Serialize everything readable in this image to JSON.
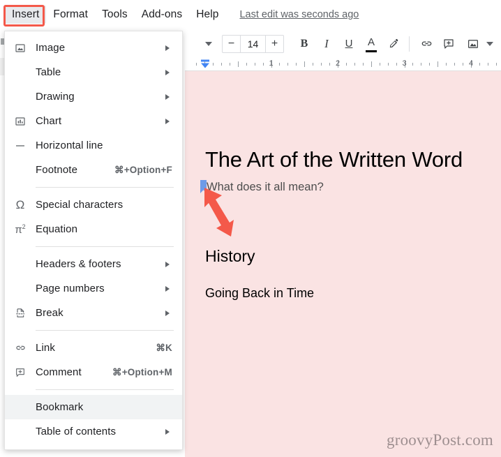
{
  "menubar": {
    "items": [
      {
        "label": "Insert",
        "active": true
      },
      {
        "label": "Format",
        "active": false
      },
      {
        "label": "Tools",
        "active": false
      },
      {
        "label": "Add-ons",
        "active": false
      },
      {
        "label": "Help",
        "active": false
      }
    ],
    "last_edit": "Last edit was seconds ago"
  },
  "toolbar": {
    "font_dropdown_icon": "caret-down-icon",
    "decrease_font_label": "−",
    "font_size_value": "14",
    "increase_font_label": "+",
    "bold_label": "B",
    "italic_label": "I",
    "underline_label": "U",
    "text_color_label": "A",
    "highlight_icon": "pen-highlight-icon",
    "link_icon": "link-icon",
    "comment_icon": "add-comment-icon",
    "image_icon": "insert-image-icon",
    "image_dropdown_icon": "caret-down-icon",
    "align_icon": "align-left-icon"
  },
  "ruler": {
    "numbers": [
      "1",
      "2",
      "3",
      "4"
    ],
    "indent_marker": "indent-marker-icon"
  },
  "insert_menu": {
    "groups": [
      {
        "rows": [
          {
            "icon": "image-icon",
            "label": "Image",
            "shortcut": "",
            "submenu": true,
            "highlight": false
          },
          {
            "icon": "",
            "label": "Table",
            "shortcut": "",
            "submenu": true,
            "highlight": false
          },
          {
            "icon": "",
            "label": "Drawing",
            "shortcut": "",
            "submenu": true,
            "highlight": false
          },
          {
            "icon": "chart-icon",
            "label": "Chart",
            "shortcut": "",
            "submenu": true,
            "highlight": false
          },
          {
            "icon": "horizontal-line-icon",
            "label": "Horizontal line",
            "shortcut": "",
            "submenu": false,
            "highlight": false
          },
          {
            "icon": "",
            "label": "Footnote",
            "shortcut": "⌘+Option+F",
            "submenu": false,
            "highlight": false
          }
        ]
      },
      {
        "rows": [
          {
            "icon": "omega-icon",
            "label": "Special characters",
            "shortcut": "",
            "submenu": false,
            "highlight": false
          },
          {
            "icon": "equation-icon",
            "label": "Equation",
            "shortcut": "",
            "submenu": false,
            "highlight": false
          }
        ]
      },
      {
        "rows": [
          {
            "icon": "",
            "label": "Headers & footers",
            "shortcut": "",
            "submenu": true,
            "highlight": false
          },
          {
            "icon": "",
            "label": "Page numbers",
            "shortcut": "",
            "submenu": true,
            "highlight": false
          },
          {
            "icon": "break-icon",
            "label": "Break",
            "shortcut": "",
            "submenu": true,
            "highlight": false
          }
        ]
      },
      {
        "rows": [
          {
            "icon": "link-icon",
            "label": "Link",
            "shortcut": "⌘K",
            "submenu": false,
            "highlight": false
          },
          {
            "icon": "comment-icon",
            "label": "Comment",
            "shortcut": "⌘+Option+M",
            "submenu": false,
            "highlight": false
          }
        ]
      },
      {
        "rows": [
          {
            "icon": "",
            "label": "Bookmark",
            "shortcut": "",
            "submenu": false,
            "highlight": true
          },
          {
            "icon": "",
            "label": "Table of contents",
            "shortcut": "",
            "submenu": true,
            "highlight": false
          }
        ]
      }
    ]
  },
  "document": {
    "title": "The Art of the Written Word",
    "subtitle": "What does it all mean?",
    "heading": "History",
    "paragraph": "Going Back in Time",
    "bookmark_marker": "bookmark-ribbon-icon",
    "watermark": "groovyPost.com",
    "background_color": "#fae3e3"
  },
  "annotations": {
    "insert_box": "red-highlight-box",
    "bookmark_box": "red-highlight-box",
    "arrow": "red-arrow-pointer",
    "accent_color": "#f4594a"
  }
}
